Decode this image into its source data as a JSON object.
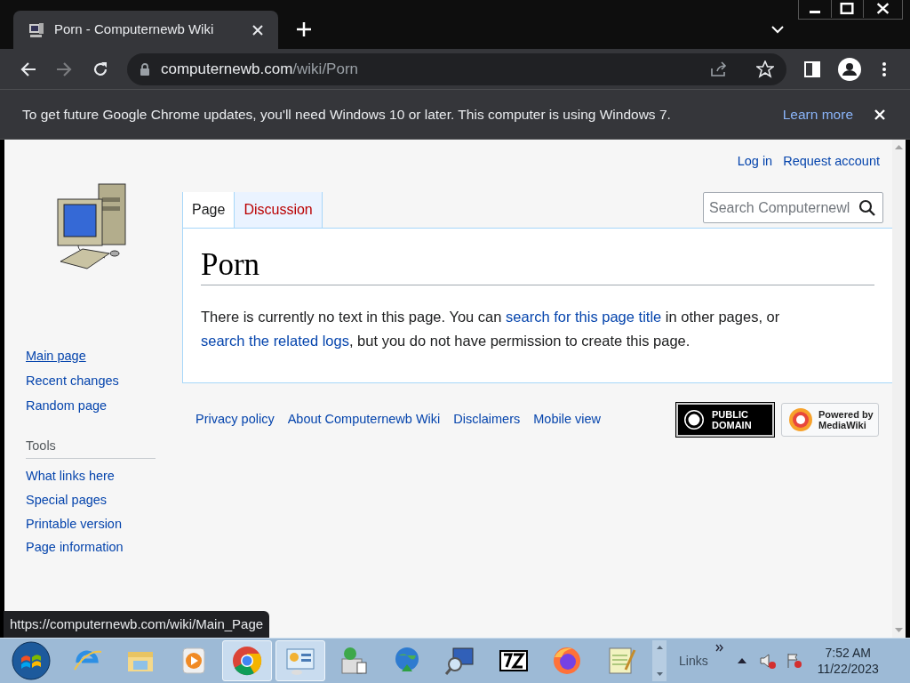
{
  "tab": {
    "title": "Porn - Computernewb Wiki",
    "selected": true
  },
  "address_bar": {
    "host": "computernewb.com",
    "path": "/wiki/Porn"
  },
  "infobar": {
    "message": "To get future Google Chrome updates, you'll need Windows 10 or later. This computer is using Windows 7.",
    "link": "Learn more"
  },
  "wiki": {
    "personal_links": [
      "Log in",
      "Request account"
    ],
    "search": {
      "placeholder": "Search Computernewl"
    },
    "tabs": [
      {
        "label": "Page",
        "selected": true
      },
      {
        "label": "Discussion",
        "selected": false
      }
    ],
    "title": "Porn",
    "notice": [
      {
        "kind": "text",
        "text": "There is currently no text in this page. You can "
      },
      {
        "kind": "link",
        "text": "search for this page title"
      },
      {
        "kind": "text",
        "text": " in other pages, or "
      },
      {
        "kind": "link",
        "text": "search the related logs"
      },
      {
        "kind": "text",
        "text": ", but you do not have permission to create this page."
      }
    ],
    "navigation": [
      {
        "label": "Main page",
        "hovered": true
      },
      {
        "label": "Recent changes",
        "hovered": false
      },
      {
        "label": "Random page",
        "hovered": false
      }
    ],
    "tools_heading": "Tools",
    "tools": [
      "What links here",
      "Special pages",
      "Printable version",
      "Page information"
    ],
    "footer_links": [
      "Privacy policy",
      "About Computernewb Wiki",
      "Disclaimers",
      "Mobile view"
    ],
    "public_domain_badge": [
      "PUBLIC",
      "DOMAIN"
    ],
    "mediawiki_badge": [
      "Powered by",
      "MediaWiki"
    ]
  },
  "status_url": "https://computernewb.com/wiki/Main_Page",
  "taskbar": {
    "apps": [
      {
        "kind": "ie",
        "running": false
      },
      {
        "kind": "folder",
        "running": false
      },
      {
        "kind": "media",
        "running": false
      },
      {
        "kind": "chrome",
        "running": true
      },
      {
        "kind": "panel",
        "running": true
      },
      {
        "kind": "installer",
        "running": false
      },
      {
        "kind": "globe",
        "running": false
      },
      {
        "kind": "monitor",
        "running": false
      },
      {
        "kind": "sevenzip",
        "running": false
      },
      {
        "kind": "firefox",
        "running": false
      },
      {
        "kind": "notepad",
        "running": false
      }
    ],
    "links": "Links",
    "time": "7:52 AM",
    "date": "11/22/2023"
  }
}
